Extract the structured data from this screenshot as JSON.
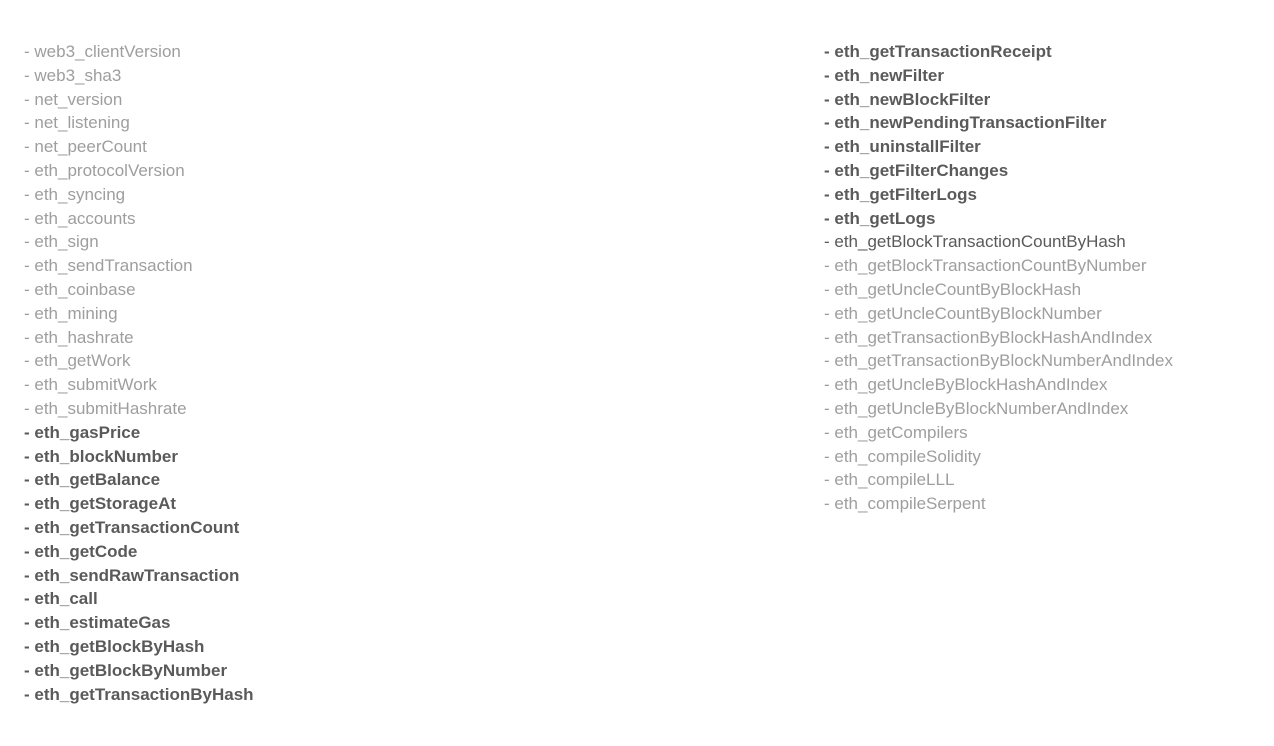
{
  "left": [
    {
      "text": "- web3_clientVersion",
      "style": "muted"
    },
    {
      "text": "- web3_sha3",
      "style": "muted"
    },
    {
      "text": "- net_version",
      "style": "muted"
    },
    {
      "text": "- net_listening",
      "style": "muted"
    },
    {
      "text": "- net_peerCount",
      "style": "muted"
    },
    {
      "text": "- eth_protocolVersion",
      "style": "muted"
    },
    {
      "text": "- eth_syncing",
      "style": "muted"
    },
    {
      "text": "- eth_accounts",
      "style": "muted"
    },
    {
      "text": "- eth_sign",
      "style": "muted"
    },
    {
      "text": "- eth_sendTransaction",
      "style": "muted"
    },
    {
      "text": "- eth_coinbase",
      "style": "muted"
    },
    {
      "text": "- eth_mining",
      "style": "muted"
    },
    {
      "text": "- eth_hashrate",
      "style": "muted"
    },
    {
      "text": "- eth_getWork",
      "style": "muted"
    },
    {
      "text": "- eth_submitWork",
      "style": "muted"
    },
    {
      "text": "- eth_submitHashrate",
      "style": "muted"
    },
    {
      "text": "- eth_gasPrice",
      "style": "bold"
    },
    {
      "text": "- eth_blockNumber",
      "style": "bold"
    },
    {
      "text": "- eth_getBalance",
      "style": "bold"
    },
    {
      "text": "- eth_getStorageAt",
      "style": "bold"
    },
    {
      "text": "- eth_getTransactionCount",
      "style": "bold"
    },
    {
      "text": "- eth_getCode",
      "style": "bold"
    },
    {
      "text": "- eth_sendRawTransaction",
      "style": "bold"
    },
    {
      "text": "- eth_call",
      "style": "bold"
    },
    {
      "text": "- eth_estimateGas",
      "style": "bold"
    },
    {
      "text": "- eth_getBlockByHash",
      "style": "bold"
    },
    {
      "text": "- eth_getBlockByNumber",
      "style": "bold"
    },
    {
      "text": "- eth_getTransactionByHash",
      "style": "bold"
    }
  ],
  "right": [
    {
      "text": "- eth_getTransactionReceipt",
      "style": "bold"
    },
    {
      "text": "- eth_newFilter",
      "style": "bold"
    },
    {
      "text": "- eth_newBlockFilter",
      "style": "bold"
    },
    {
      "text": "- eth_newPendingTransactionFilter",
      "style": "bold"
    },
    {
      "text": "- eth_uninstallFilter",
      "style": "bold"
    },
    {
      "text": "- eth_getFilterChanges",
      "style": "bold"
    },
    {
      "text": "- eth_getFilterLogs",
      "style": "bold"
    },
    {
      "text": "- eth_getLogs",
      "style": "bold"
    },
    {
      "text": "- eth_getBlockTransactionCountByHash",
      "style": "medium"
    },
    {
      "text": "- eth_getBlockTransactionCountByNumber",
      "style": "muted"
    },
    {
      "text": "- eth_getUncleCountByBlockHash",
      "style": "muted"
    },
    {
      "text": "- eth_getUncleCountByBlockNumber",
      "style": "muted"
    },
    {
      "text": "- eth_getTransactionByBlockHashAndIndex",
      "style": "muted"
    },
    {
      "text": "- eth_getTransactionByBlockNumberAndIndex",
      "style": "muted"
    },
    {
      "text": "- eth_getUncleByBlockHashAndIndex",
      "style": "muted"
    },
    {
      "text": "- eth_getUncleByBlockNumberAndIndex",
      "style": "muted"
    },
    {
      "text": "- eth_getCompilers",
      "style": "muted"
    },
    {
      "text": "- eth_compileSolidity",
      "style": "muted"
    },
    {
      "text": "- eth_compileLLL",
      "style": "muted"
    },
    {
      "text": "- eth_compileSerpent",
      "style": "muted"
    }
  ]
}
